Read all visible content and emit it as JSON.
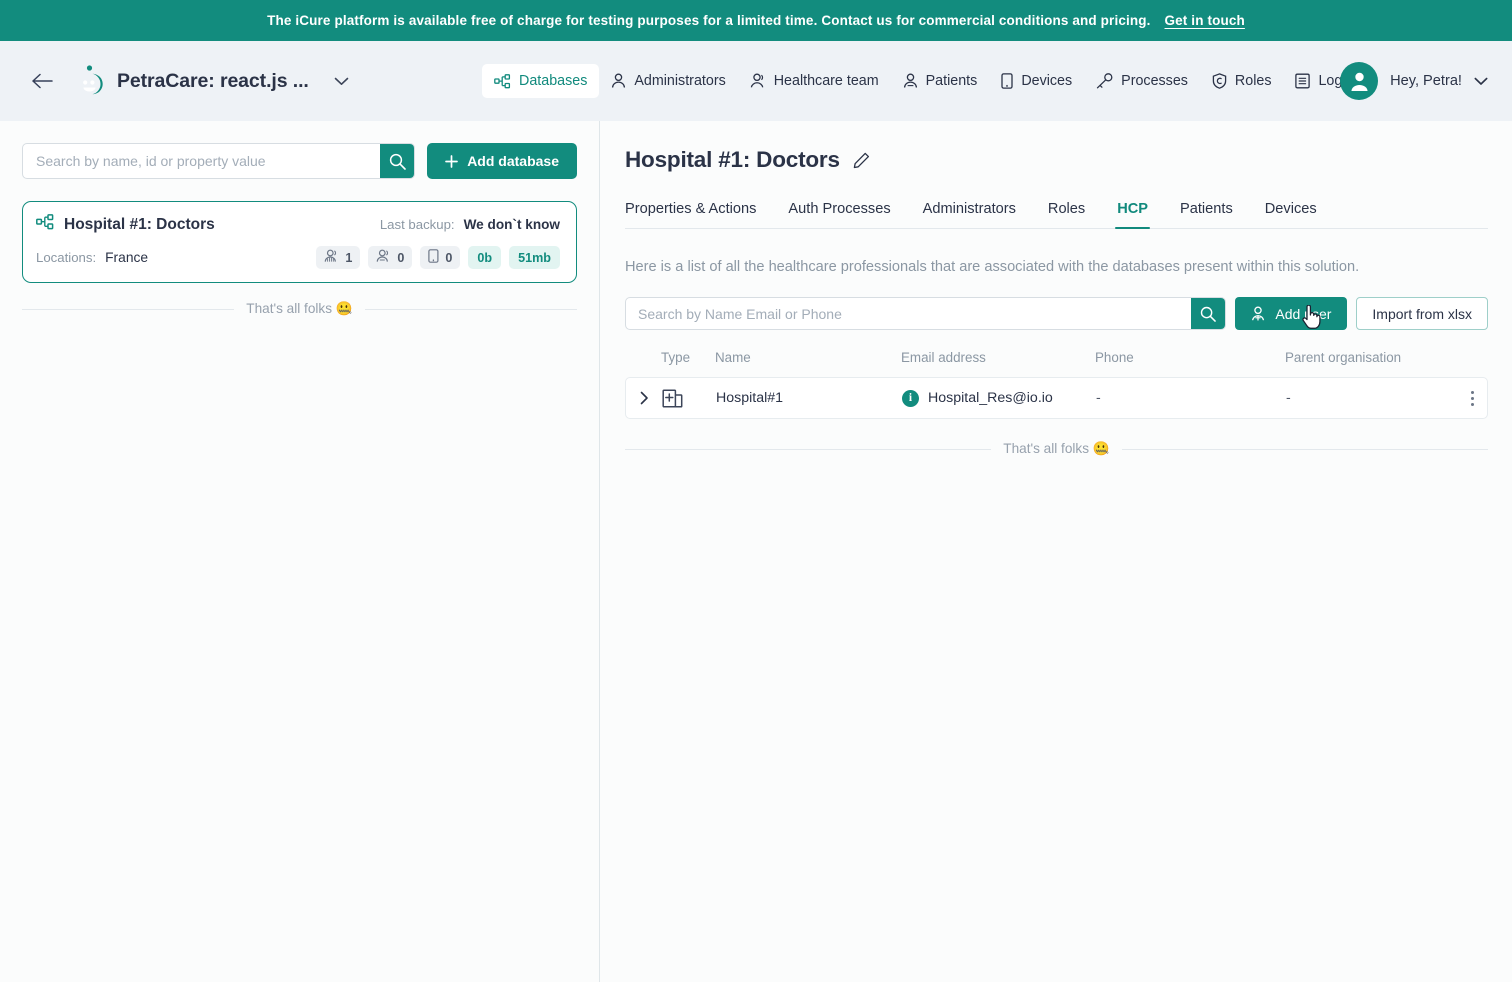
{
  "banner": {
    "text": "The iCure platform is available free of charge for testing purposes for a limited time. Contact us for commercial conditions and pricing.",
    "link_label": "Get in touch",
    "bg_color": "#128C7E"
  },
  "header": {
    "back_label": "←",
    "brand_title": "PetraCare: react.js ...",
    "nav": [
      {
        "label": "Databases",
        "icon": "database-nodes-icon",
        "active": true
      },
      {
        "label": "Administrators",
        "icon": "person-icon",
        "active": false
      },
      {
        "label": "Healthcare team",
        "icon": "people-icon",
        "active": false
      },
      {
        "label": "Patients",
        "icon": "patient-icon",
        "active": false
      },
      {
        "label": "Devices",
        "icon": "device-icon",
        "active": false
      },
      {
        "label": "Processes",
        "icon": "key-icon",
        "active": false
      },
      {
        "label": "Roles",
        "icon": "shield-icon",
        "active": false
      },
      {
        "label": "Logs",
        "icon": "list-icon",
        "active": false
      }
    ],
    "user_greeting": "Hey, Petra!",
    "accent_color": "#128C7E"
  },
  "sidebar": {
    "search": {
      "placeholder": "Search by name, id or property value",
      "value": ""
    },
    "add_database_label": "Add database",
    "databases": [
      {
        "name": "Hospital #1: Doctors",
        "backup_label": "Last backup:",
        "backup_value": "We don`t know",
        "locations_label": "Locations:",
        "locations_value": "France",
        "stats": [
          {
            "icon": "hcp-group-icon",
            "value": "1",
            "accent": false
          },
          {
            "icon": "patient-group-icon",
            "value": "0",
            "accent": false
          },
          {
            "icon": "device-icon",
            "value": "0",
            "accent": false
          },
          {
            "icon": "",
            "value": "0b",
            "accent": true
          },
          {
            "icon": "",
            "value": "51mb",
            "accent": true
          }
        ]
      }
    ],
    "end_of_list": "That's all folks 🤐"
  },
  "main": {
    "title": "Hospital #1: Doctors",
    "tabs": [
      {
        "label": "Properties & Actions",
        "active": false
      },
      {
        "label": "Auth Processes",
        "active": false
      },
      {
        "label": "Administrators",
        "active": false
      },
      {
        "label": "Roles",
        "active": false
      },
      {
        "label": "HCP",
        "active": true
      },
      {
        "label": "Patients",
        "active": false
      },
      {
        "label": "Devices",
        "active": false
      }
    ],
    "description": "Here is a list of all the healthcare professionals that are associated with the databases present within this solution.",
    "search": {
      "placeholder": "Search by Name Email or Phone",
      "value": ""
    },
    "add_user_label": "Add user",
    "import_label": "Import from xlsx",
    "table": {
      "columns": [
        "Type",
        "Name",
        "Email address",
        "Phone",
        "Parent organisation"
      ],
      "rows": [
        {
          "type_icon": "hospital-building-icon",
          "name": "Hospital#1",
          "email": "Hospital_Res@io.io",
          "phone": "-",
          "parent_organisation": "-"
        }
      ]
    },
    "end_of_list": "That's all folks 🤐"
  }
}
